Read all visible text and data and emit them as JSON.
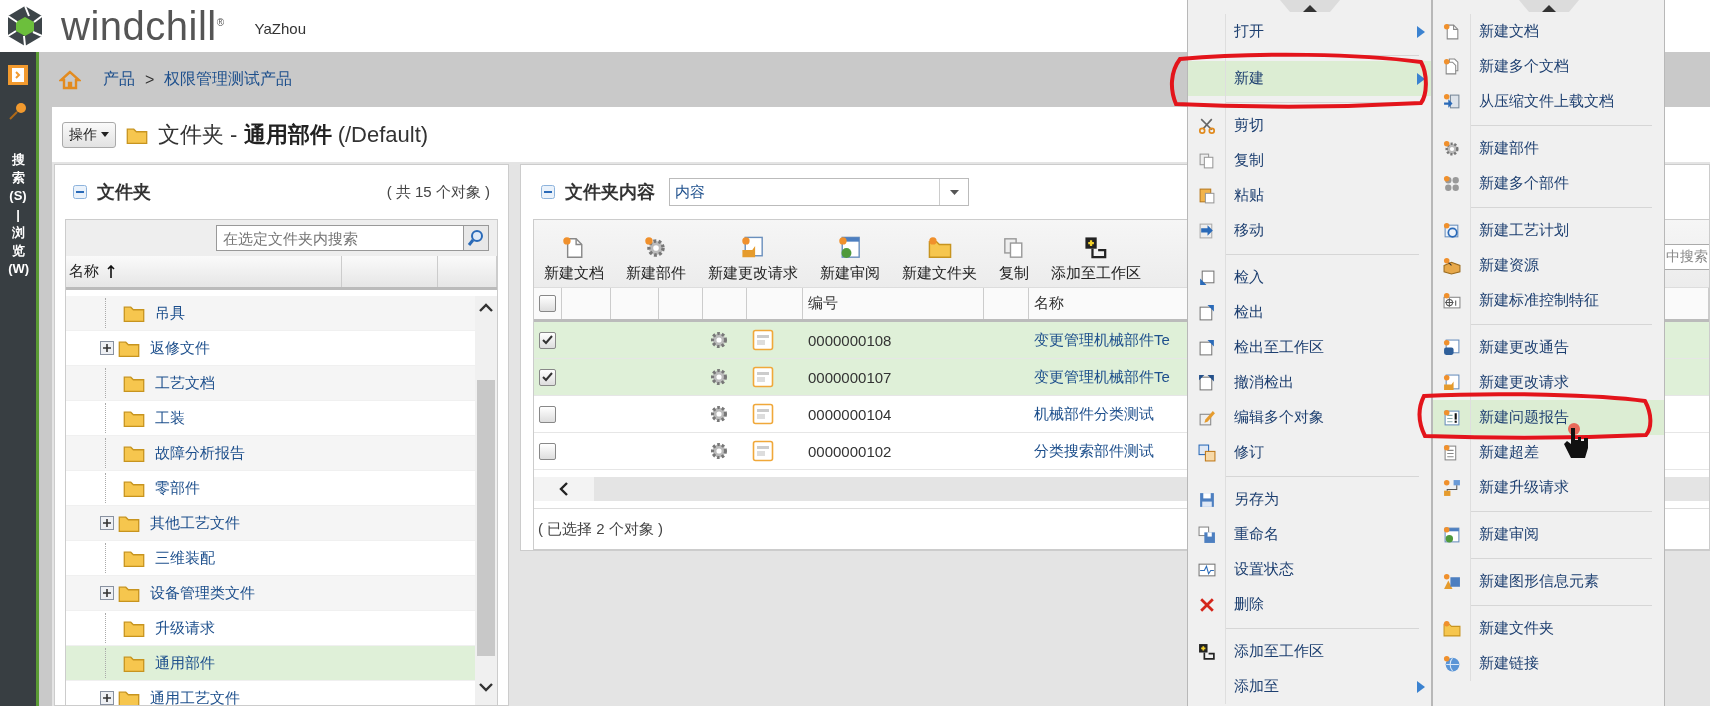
{
  "header": {
    "brand": "windchill$^{®}$",
    "user": "YaZhou"
  },
  "sidebar": {
    "label": "搜索(S) | 浏览(W)"
  },
  "breadcrumb": {
    "items": [
      "产品",
      "权限管理测试产品"
    ],
    "separator": ">"
  },
  "page_title": {
    "actions_button": "操作",
    "text": "文件夹 - **通用部件** (/Default)"
  },
  "folder_panel": {
    "title": "文件夹",
    "count": "( 共 15 个对象 )",
    "search_placeholder": "在选定文件夹内搜索",
    "column": "名称",
    "items": [
      {
        "label": "吊具",
        "kind": "leaf",
        "selected": false
      },
      {
        "label": "返修文件",
        "kind": "expandable",
        "selected": false
      },
      {
        "label": "工艺文档",
        "kind": "leaf",
        "selected": false
      },
      {
        "label": "工装",
        "kind": "leaf",
        "selected": false
      },
      {
        "label": "故障分析报告",
        "kind": "leaf",
        "selected": false
      },
      {
        "label": "零部件",
        "kind": "leaf",
        "selected": false
      },
      {
        "label": "其他工艺文件",
        "kind": "expandable",
        "selected": false
      },
      {
        "label": "三维装配",
        "kind": "leaf",
        "selected": false
      },
      {
        "label": "设备管理类文件",
        "kind": "expandable",
        "selected": false
      },
      {
        "label": "升级请求",
        "kind": "leaf",
        "selected": false
      },
      {
        "label": "通用部件",
        "kind": "leaf",
        "selected": true
      },
      {
        "label": "通用工艺文件",
        "kind": "expandable",
        "selected": false
      }
    ]
  },
  "content_panel": {
    "title": "文件夹内容",
    "view": "内容",
    "toolbar": [
      "新建文档",
      "新建部件",
      "新建更改请求",
      "新建审阅",
      "新建文件夹",
      "复制",
      "添加至工作区"
    ],
    "search_placeholder": "中搜索",
    "select_all_checked": false,
    "columns": [
      "编号",
      "名称"
    ],
    "rows": [
      {
        "checked": true,
        "number": "0000000108",
        "name": "变更管理机械部件Te"
      },
      {
        "checked": true,
        "number": "0000000107",
        "name": "变更管理机械部件Te"
      },
      {
        "checked": false,
        "number": "0000000104",
        "name": "机械部件分类测试"
      },
      {
        "checked": false,
        "number": "0000000102",
        "name": "分类搜索部件测试"
      }
    ],
    "status": "( 已选择 2 个对象 )"
  },
  "context_menu": {
    "sections": [
      [
        {
          "label": "打开",
          "submenu": true,
          "selected": false
        }
      ],
      [
        {
          "label": "新建",
          "submenu": true,
          "selected": true
        }
      ],
      [
        {
          "label": "剪切",
          "submenu": false,
          "selected": false
        },
        {
          "label": "复制",
          "submenu": false,
          "selected": false
        },
        {
          "label": "粘贴",
          "submenu": false,
          "selected": false
        },
        {
          "label": "移动",
          "submenu": false,
          "selected": false
        }
      ],
      [
        {
          "label": "检入",
          "submenu": false,
          "selected": false
        },
        {
          "label": "检出",
          "submenu": false,
          "selected": false
        },
        {
          "label": "检出至工作区",
          "submenu": false,
          "selected": false
        },
        {
          "label": "撤消检出",
          "submenu": false,
          "selected": false
        },
        {
          "label": "编辑多个对象",
          "submenu": false,
          "selected": false
        },
        {
          "label": "修订",
          "submenu": false,
          "selected": false
        }
      ],
      [
        {
          "label": "另存为",
          "submenu": false,
          "selected": false
        },
        {
          "label": "重命名",
          "submenu": false,
          "selected": false
        },
        {
          "label": "设置状态",
          "submenu": false,
          "selected": false
        },
        {
          "label": "删除",
          "submenu": false,
          "selected": false
        }
      ],
      [
        {
          "label": "添加至工作区",
          "submenu": false,
          "selected": false
        },
        {
          "label": "添加至",
          "submenu": true,
          "selected": false
        }
      ]
    ]
  },
  "submenu": {
    "sections": [
      [
        {
          "label": "新建文档",
          "submenu": false,
          "selected": false
        },
        {
          "label": "新建多个文档",
          "submenu": false,
          "selected": false
        },
        {
          "label": "从压缩文件上载文档",
          "submenu": false,
          "selected": false
        }
      ],
      [
        {
          "label": "新建部件",
          "submenu": false,
          "selected": false
        },
        {
          "label": "新建多个部件",
          "submenu": false,
          "selected": false
        }
      ],
      [
        {
          "label": "新建工艺计划",
          "submenu": false,
          "selected": false
        },
        {
          "label": "新建资源",
          "submenu": false,
          "selected": false
        },
        {
          "label": "新建标准控制特征",
          "submenu": false,
          "selected": false
        }
      ],
      [
        {
          "label": "新建更改通告",
          "submenu": false,
          "selected": false
        },
        {
          "label": "新建更改请求",
          "submenu": false,
          "selected": false
        },
        {
          "label": "新建问题报告",
          "submenu": false,
          "selected": true
        },
        {
          "label": "新建超差",
          "submenu": false,
          "selected": false
        },
        {
          "label": "新建升级请求",
          "submenu": false,
          "selected": false
        }
      ],
      [
        {
          "label": "新建审阅",
          "submenu": false,
          "selected": false
        }
      ],
      [
        {
          "label": "新建图形信息元素",
          "submenu": false,
          "selected": false
        }
      ],
      [
        {
          "label": "新建文件夹",
          "submenu": false,
          "selected": false
        },
        {
          "label": "新建链接",
          "submenu": false,
          "selected": false
        }
      ]
    ]
  }
}
